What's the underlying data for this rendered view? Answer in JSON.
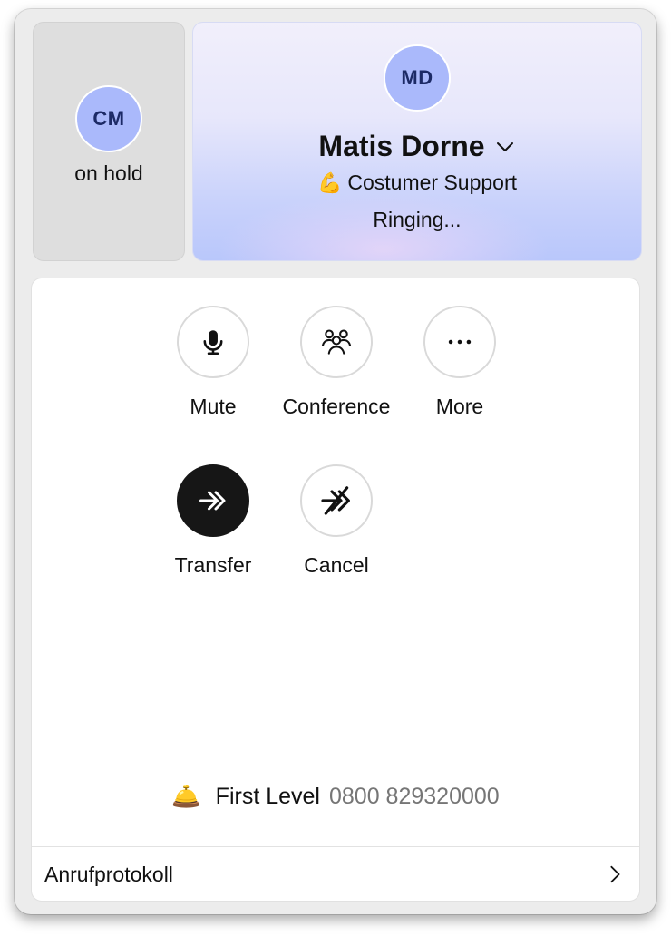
{
  "held_call": {
    "initials": "CM",
    "status": "on hold"
  },
  "active_call": {
    "initials": "MD",
    "name": "Matis Dorne",
    "queue_emoji": "💪",
    "queue": "Costumer Support",
    "state": "Ringing..."
  },
  "actions": {
    "mute": "Mute",
    "conference": "Conference",
    "more": "More",
    "transfer": "Transfer",
    "cancel": "Cancel"
  },
  "line": {
    "emoji": "🛎️",
    "name": "First Level",
    "number": "0800 829320000"
  },
  "footer": {
    "call_log": "Anrufprotokoll"
  },
  "colors": {
    "avatar_bg": "#aab9fb",
    "avatar_text": "#1c2a66",
    "primary_button": "#161616",
    "held_card_bg": "#dedede",
    "number_text": "#767676"
  }
}
